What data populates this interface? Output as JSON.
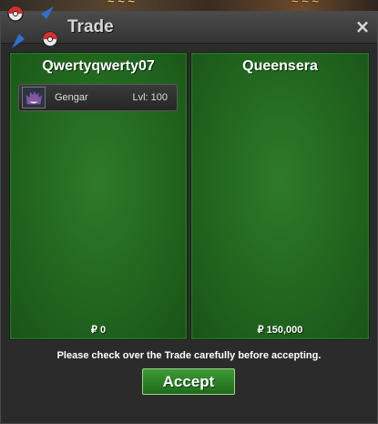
{
  "window": {
    "title": "Trade",
    "close_glyph": "×"
  },
  "trade": {
    "left": {
      "player": "Qwertyqwerty07",
      "items": [
        {
          "name": "Gengar",
          "level": "Lvl: 100",
          "icon": "gengar-icon"
        }
      ],
      "money": "₽ 0"
    },
    "right": {
      "player": "Queensera",
      "items": [],
      "money": "₽ 150,000"
    },
    "notice": "Please check over the Trade carefully before accepting.",
    "accept_label": "Accept"
  },
  "colors": {
    "panel_green": "#236a20",
    "window_bg": "#2b2b2b",
    "accept_green": "#2f8a28"
  }
}
